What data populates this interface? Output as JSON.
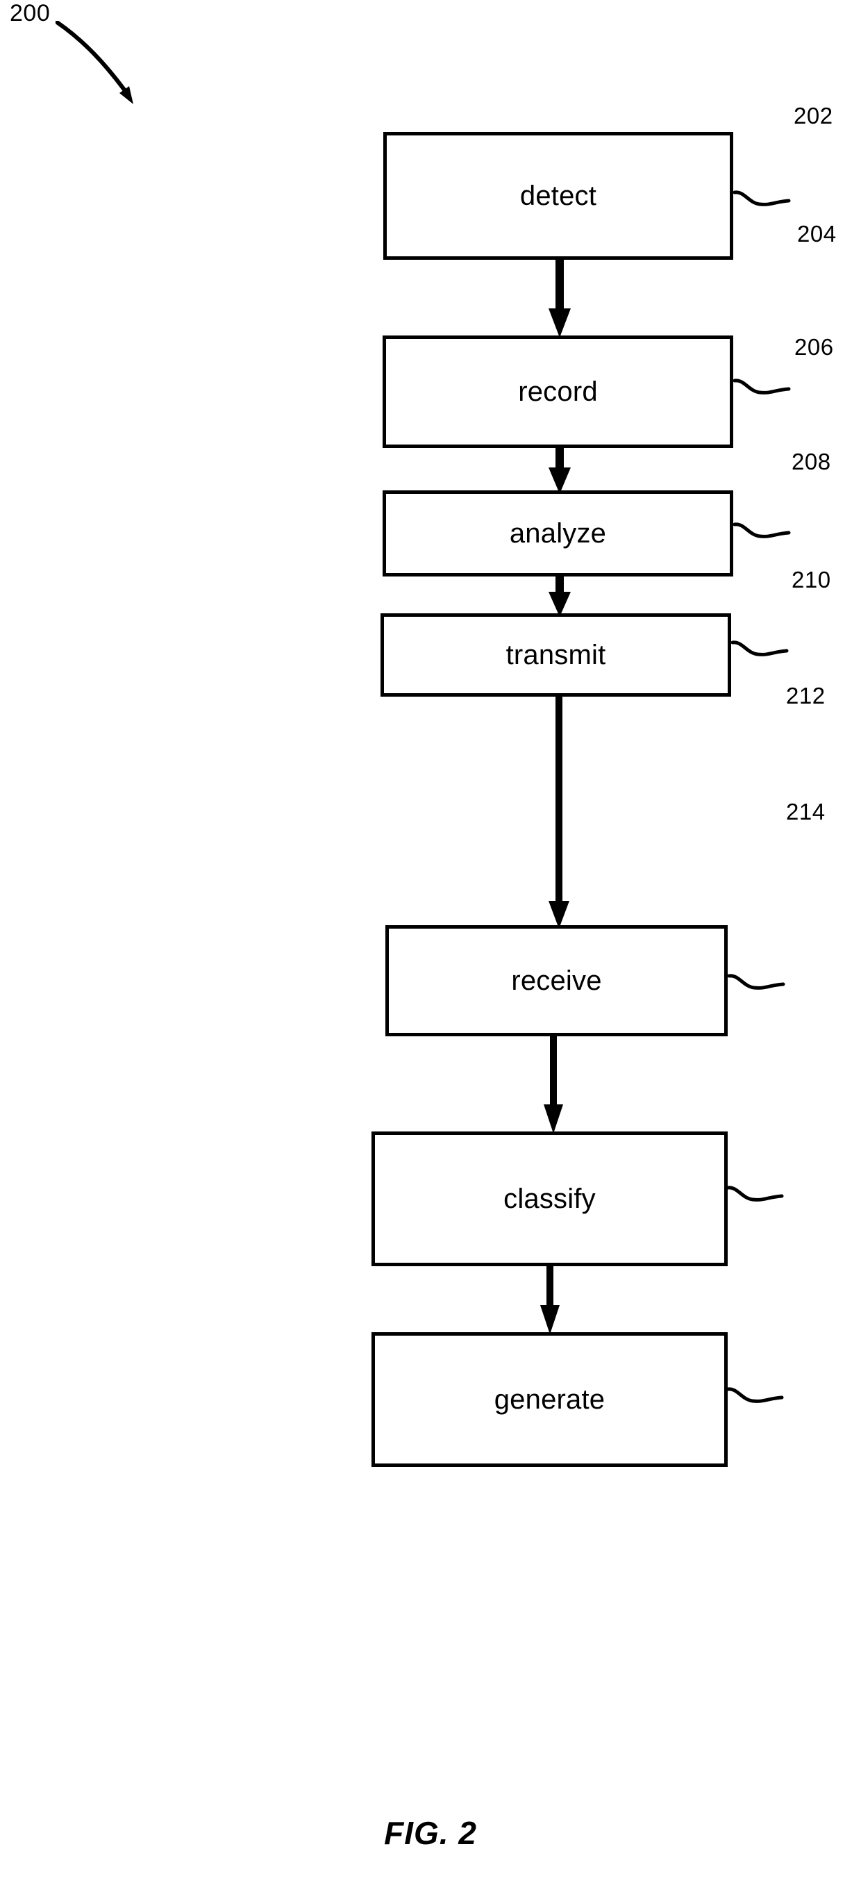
{
  "figure": {
    "caption": "FIG. 2",
    "diagram_reference": "200"
  },
  "chart_data": {
    "type": "diagram",
    "diagram_kind": "flowchart",
    "orientation": "vertical",
    "title": "FIG. 2",
    "reference_numeral": "200",
    "node_count": 7,
    "nodes": [
      {
        "label": "detect",
        "ref": "202"
      },
      {
        "label": "record",
        "ref": "204"
      },
      {
        "label": "analyze",
        "ref": "206"
      },
      {
        "label": "transmit",
        "ref": "208"
      },
      {
        "label": "receive",
        "ref": "210"
      },
      {
        "label": "classify",
        "ref": "212"
      },
      {
        "label": "generate",
        "ref": "214"
      }
    ],
    "edges": [
      {
        "from": "detect",
        "to": "record"
      },
      {
        "from": "record",
        "to": "analyze"
      },
      {
        "from": "analyze",
        "to": "transmit"
      },
      {
        "from": "transmit",
        "to": "receive"
      },
      {
        "from": "receive",
        "to": "classify"
      },
      {
        "from": "classify",
        "to": "generate"
      }
    ]
  },
  "steps": [
    {
      "label": "detect",
      "ref": "202"
    },
    {
      "label": "record",
      "ref": "204"
    },
    {
      "label": "analyze",
      "ref": "206"
    },
    {
      "label": "transmit",
      "ref": "208"
    },
    {
      "label": "receive",
      "ref": "210"
    },
    {
      "label": "classify",
      "ref": "212"
    },
    {
      "label": "generate",
      "ref": "214"
    }
  ],
  "colors": {
    "ink": "#000000",
    "paper": "#ffffff"
  }
}
